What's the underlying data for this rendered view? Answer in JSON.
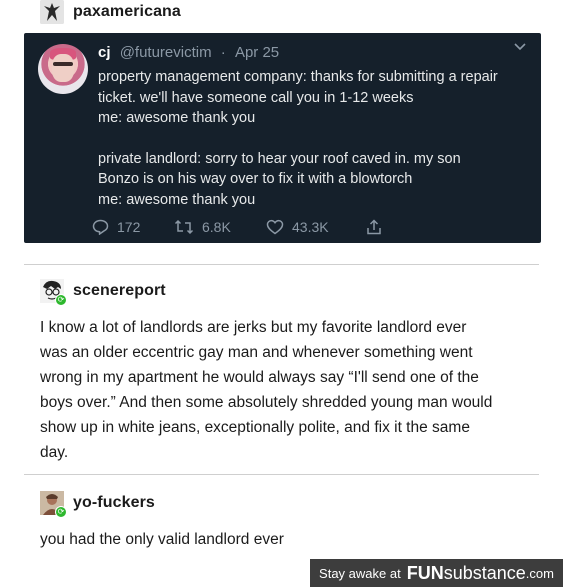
{
  "posts": [
    {
      "username": "paxamericana",
      "tweet": {
        "name": "cj",
        "handle": "@futurevictim",
        "separator": "·",
        "date": "Apr 25",
        "paragraphs": [
          [
            "property management company: thanks for submitting a repair",
            "ticket. we'll have someone call you in 1-12 weeks",
            "me: awesome thank you"
          ],
          [
            "private landlord: sorry to hear your roof caved in. my son",
            "Bonzo is on his way over to fix it with a blowtorch",
            "me: awesome thank you"
          ]
        ],
        "replies": "172",
        "retweets": "6.8K",
        "likes": "43.3K"
      }
    },
    {
      "username": "scenereport",
      "lines": [
        "I know a lot of landlords are jerks but my favorite landlord ever",
        "was an older eccentric gay man and whenever something went",
        "wrong in my apartment he would always say “I'll send one of the",
        "boys over.” And then some absolutely shredded young man would",
        "show up in white jeans, exceptionally polite, and fix it the same",
        "day."
      ]
    },
    {
      "username": "yo-fuckers",
      "lines": [
        "you had the only valid landlord ever"
      ]
    }
  ],
  "watermark": {
    "text": "Stay awake at",
    "brand_bold": "FUN",
    "brand_rest": "substance",
    "tld": ".com"
  }
}
